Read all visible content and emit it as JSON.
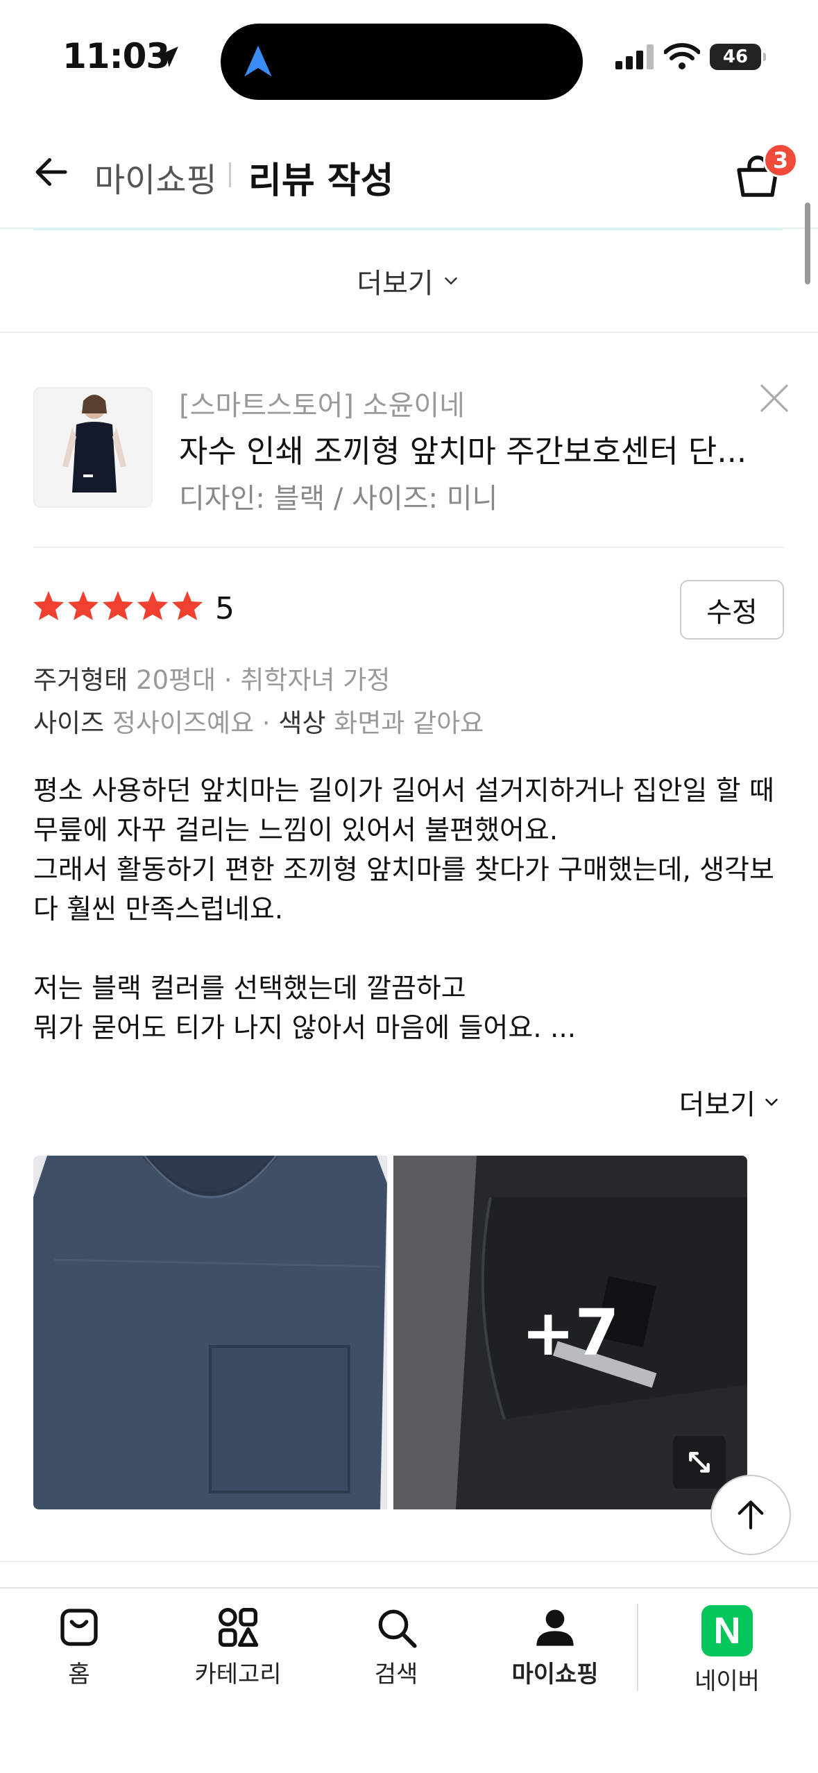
{
  "status_bar": {
    "time": "11:03",
    "battery": "46"
  },
  "header": {
    "section": "마이쇼핑",
    "title": "리뷰 작성",
    "cart_count": "3"
  },
  "more_top_label": "더보기",
  "product": {
    "store": "[스마트스토어] 소윤이네",
    "name": "자수 인쇄 조끼형 앞치마 주간보호센터 단...",
    "options": "디자인: 블랙 / 사이즈: 미니"
  },
  "rating": {
    "stars": 5,
    "score": "5",
    "edit_label": "수정"
  },
  "attributes": {
    "housing_label": "주거형태",
    "housing_value": "20평대 · 취학자녀 가정",
    "size_label": "사이즈",
    "size_value": "정사이즈예요 · ",
    "color_label": "색상",
    "color_value": "화면과 같아요"
  },
  "review_text": "평소 사용하던 앞치마는 길이가 길어서 설거지하거나 집안일 할 때 무릎에 자꾸 걸리는 느낌이 있어서 불편했어요.\n그래서 활동하기 편한 조끼형 앞치마를 찾다가 구매했는데, 생각보다 훨씬 만족스럽네요.\n\n저는 블랙 컬러를 선택했는데 깔끔하고\n뭐가 묻어도 티가 나지 않아서 마음에 들어요. ...",
  "more_body_label": "더보기",
  "photos": {
    "extra_count": "+7"
  },
  "nav": {
    "home": "홈",
    "category": "카테고리",
    "search": "검색",
    "myshopping": "마이쇼핑",
    "naver": "네이버",
    "naver_logo": "N"
  },
  "colors": {
    "star": "#f0402f",
    "badge": "#f04b3a",
    "naver_green": "#03c75a"
  }
}
